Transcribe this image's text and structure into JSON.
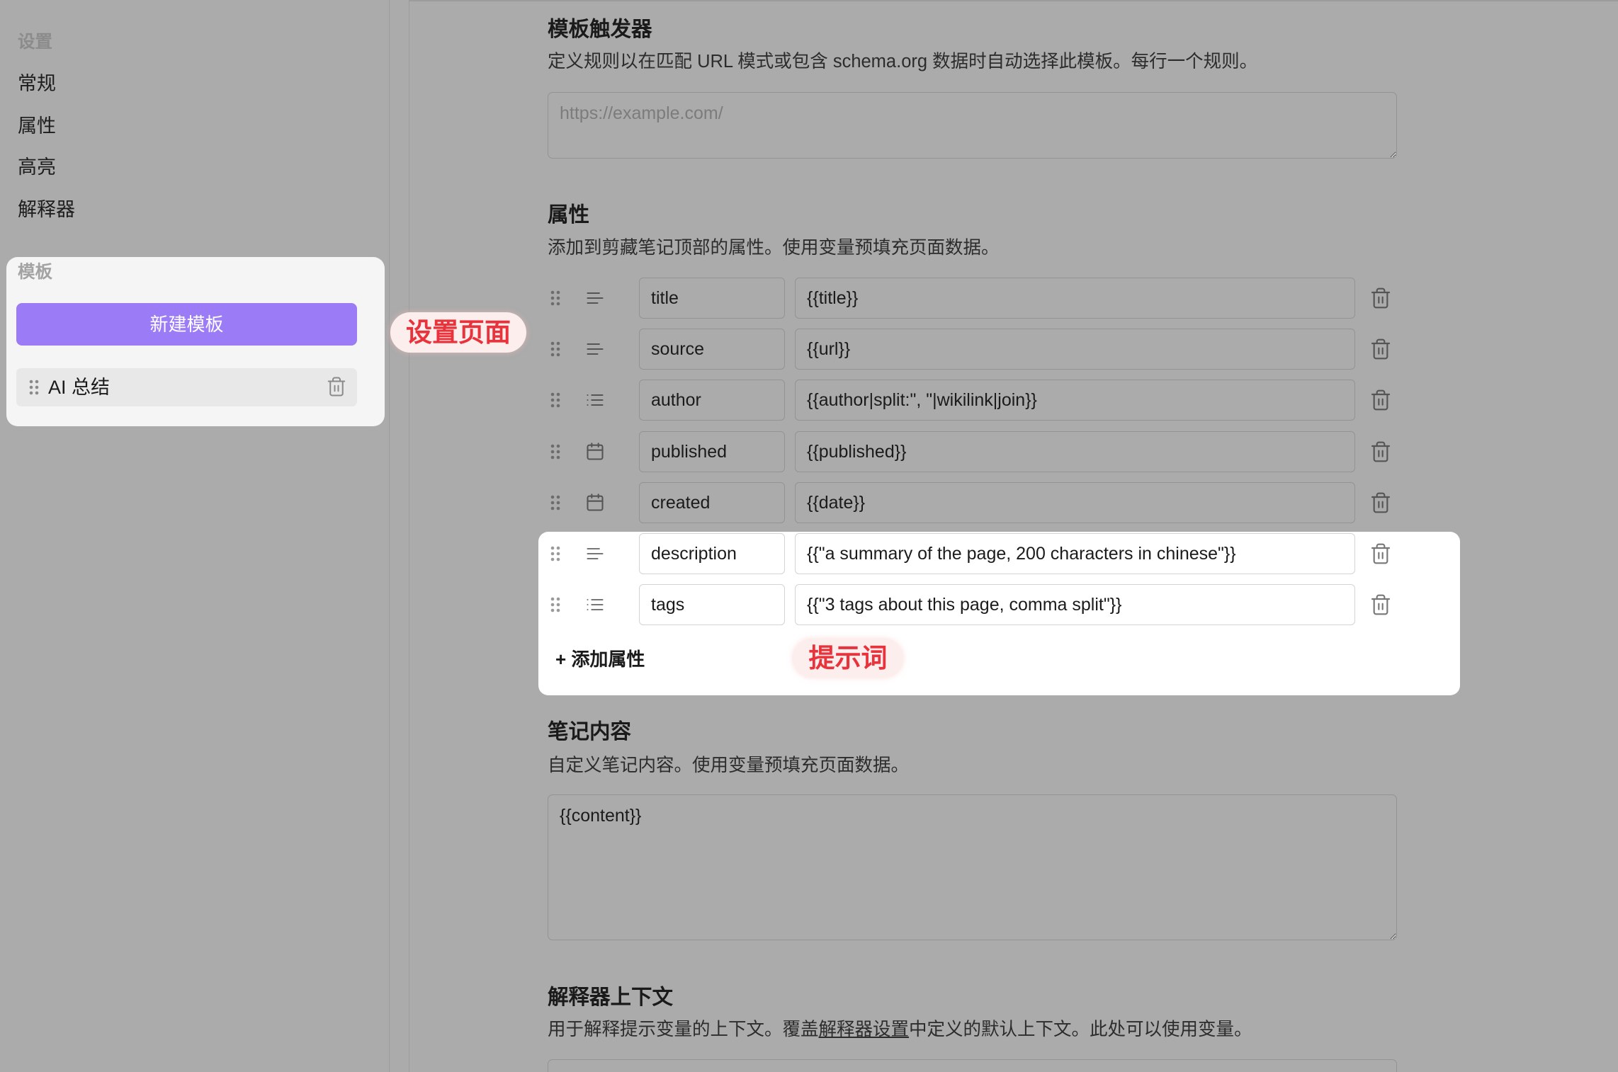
{
  "colors": {
    "accent": "#9b7cf6",
    "annotation_red": "#e8333c",
    "overlay_gray": "#ababab"
  },
  "icons": {
    "drag": "drag-handle-icon",
    "delete": "trash-icon"
  },
  "sidebar": {
    "heading": "设置",
    "items": [
      {
        "label": "常规"
      },
      {
        "label": "属性"
      },
      {
        "label": "高亮"
      },
      {
        "label": "解释器"
      }
    ],
    "templates": {
      "heading": "模板",
      "new_button_label": "新建模板",
      "items": [
        {
          "label": "AI 总结"
        }
      ]
    }
  },
  "annotations": {
    "settings_page": "设置页面",
    "prompt": "提示词"
  },
  "main": {
    "triggers": {
      "title": "模板触发器",
      "description": "定义规则以在匹配 URL 模式或包含 schema.org 数据时自动选择此模板。每行一个规则。",
      "placeholder": "https://example.com/"
    },
    "properties": {
      "title": "属性",
      "description": "添加到剪藏笔记顶部的属性。使用变量预填充页面数据。",
      "rows": [
        {
          "icon": "text-icon",
          "name": "title",
          "value": "{{title}}"
        },
        {
          "icon": "text-icon",
          "name": "source",
          "value": "{{url}}"
        },
        {
          "icon": "list-icon",
          "name": "author",
          "value": "{{author|split:\", \"|wikilink|join}}"
        },
        {
          "icon": "calendar-icon",
          "name": "published",
          "value": "{{published}}"
        },
        {
          "icon": "calendar-icon",
          "name": "created",
          "value": "{{date}}"
        },
        {
          "icon": "text-icon",
          "name": "description",
          "value": "{{\"a summary of the page, 200 characters in chinese\"}}"
        },
        {
          "icon": "list-icon",
          "name": "tags",
          "value": "{{\"3 tags about this page, comma split\"}}"
        }
      ],
      "add_label": "+ 添加属性"
    },
    "note_content": {
      "title": "笔记内容",
      "description": "自定义笔记内容。使用变量预填充页面数据。",
      "value": "{{content}}"
    },
    "interpreter_context": {
      "title": "解释器上下文",
      "description_before": "用于解释提示变量的上下文。覆盖",
      "description_link": "解释器设置",
      "description_after": "中定义的默认上下文。此处可以使用变量。"
    }
  }
}
